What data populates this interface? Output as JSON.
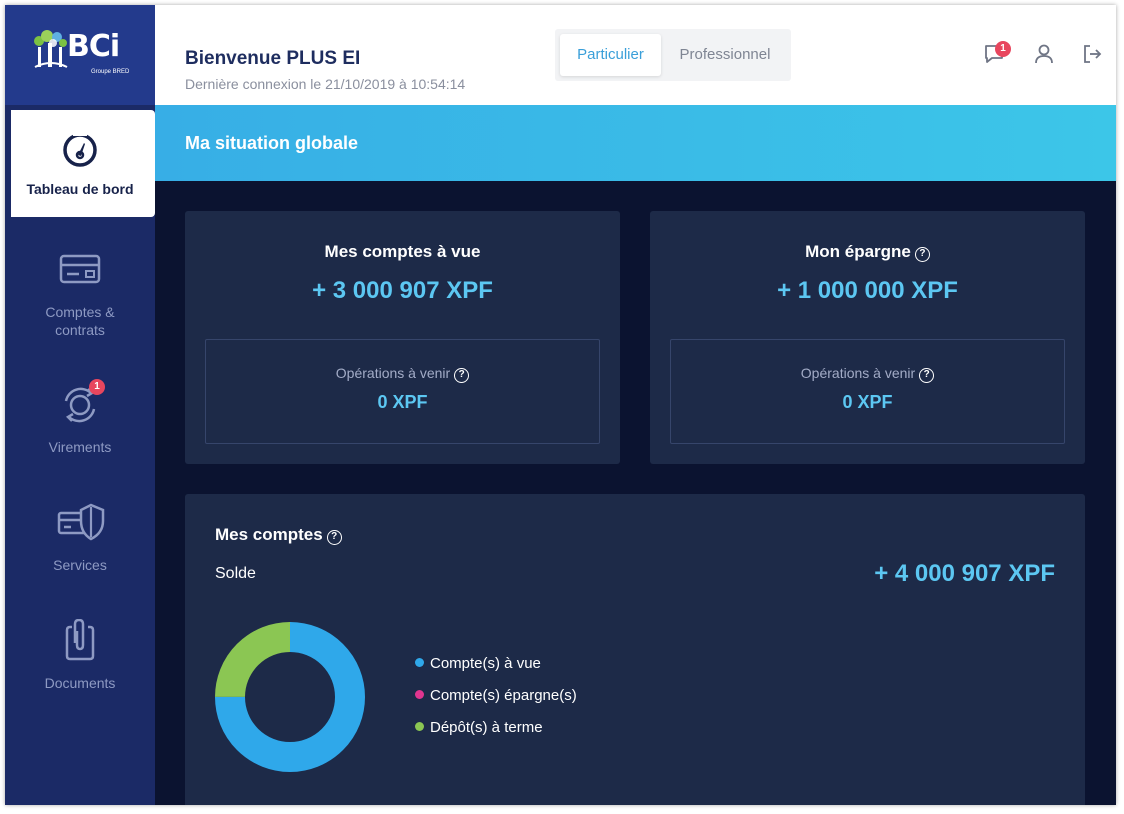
{
  "brand": {
    "name": "BCi",
    "tagline": "Groupe BRED"
  },
  "sidebar": {
    "items": [
      {
        "label": "Tableau de bord",
        "icon": "dashboard-gauge-icon",
        "active": true
      },
      {
        "label": "Comptes & contrats",
        "icon": "card-icon",
        "active": false
      },
      {
        "label": "Virements",
        "icon": "transfer-cycle-icon",
        "active": false,
        "badge": "1"
      },
      {
        "label": "Services",
        "icon": "card-shield-icon",
        "active": false
      },
      {
        "label": "Documents",
        "icon": "clipboard-clip-icon",
        "active": false
      }
    ]
  },
  "header": {
    "welcome": "Bienvenue PLUS EI",
    "last_login": "Dernière connexion le 21/10/2019 à 10:54:14",
    "segments": [
      {
        "label": "Particulier",
        "selected": true
      },
      {
        "label": "Professionnel",
        "selected": false
      }
    ],
    "messages_badge": "1",
    "icons": [
      "chat-icon",
      "user-icon",
      "logout-icon"
    ]
  },
  "banner": {
    "title": "Ma situation globale"
  },
  "cards": {
    "current_accounts": {
      "title": "Mes comptes à vue",
      "amount": "+ 3 000 907 XPF",
      "upcoming_label": "Opérations à venir",
      "upcoming_amount": "0 XPF"
    },
    "savings": {
      "title": "Mon épargne",
      "amount": "+ 1 000 000 XPF",
      "upcoming_label": "Opérations à venir",
      "upcoming_amount": "0 XPF"
    }
  },
  "accounts": {
    "title": "Mes comptes",
    "balance_label": "Solde",
    "balance_amount": "+ 4 000 907 XPF",
    "legend": [
      {
        "label": "Compte(s) à vue",
        "color": "#2fa8ea"
      },
      {
        "label": "Compte(s) épargne(s)",
        "color": "#e0358f"
      },
      {
        "label": "Dépôt(s) à terme",
        "color": "#8bc653"
      }
    ]
  },
  "colors": {
    "sidebar": "#1b2a66",
    "banner": "#37aee6",
    "card": "#1d2a48",
    "accent_amount": "#5cc7f2",
    "badge": "#e8465e"
  },
  "chart_data": {
    "type": "pie",
    "title": "",
    "categories": [
      "Compte(s) à vue",
      "Compte(s) épargne(s)",
      "Dépôt(s) à terme"
    ],
    "values": [
      75,
      0,
      25
    ],
    "colors": [
      "#2fa8ea",
      "#e0358f",
      "#8bc653"
    ],
    "donut": true
  }
}
